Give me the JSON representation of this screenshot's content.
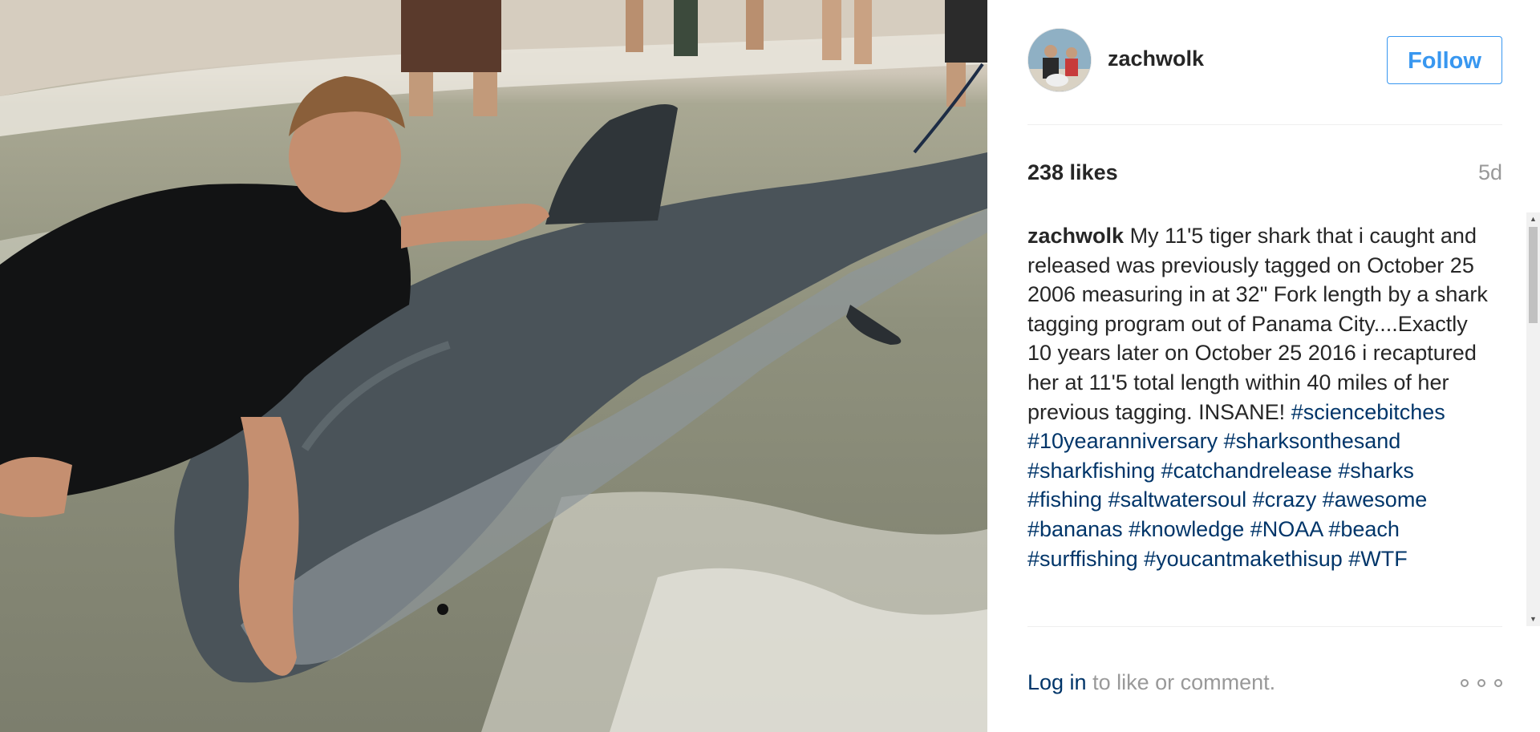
{
  "post": {
    "photo_alt": "zachwolk photo"
  },
  "header": {
    "username": "zachwolk",
    "follow_label": "Follow"
  },
  "stats": {
    "likes": "238 likes",
    "age": "5d"
  },
  "caption": {
    "author": "zachwolk",
    "text": "My 11'5 tiger shark that i caught and released was previously tagged on October 25 2006 measuring in at 32\" Fork length by a shark tagging program out of Panama City....Exactly 10 years later on October 25 2016 i recaptured her at 11'5 total length within 40 miles of her previous tagging. INSANE!",
    "hashtags": [
      "#sciencebitches",
      "#10yearanniversary",
      "#sharksonthesand",
      "#sharkfishing",
      "#catchandrelease",
      "#sharks",
      "#fishing",
      "#saltwatersoul",
      "#crazy",
      "#awesome",
      "#bananas",
      "#knowledge",
      "#NOAA",
      "#beach",
      "#surffishing",
      "#youcantmakethisup",
      "#WTF"
    ]
  },
  "footer": {
    "login_link": "Log in",
    "login_suffix": " to like or comment."
  },
  "colors": {
    "follow_blue": "#3897f0",
    "hashtag_blue": "#003569",
    "muted_gray": "#999999"
  },
  "icons": {
    "more_options": "three-dots-icon",
    "scroll_up": "scroll-up-arrow-icon",
    "scroll_down": "scroll-down-arrow-icon"
  }
}
